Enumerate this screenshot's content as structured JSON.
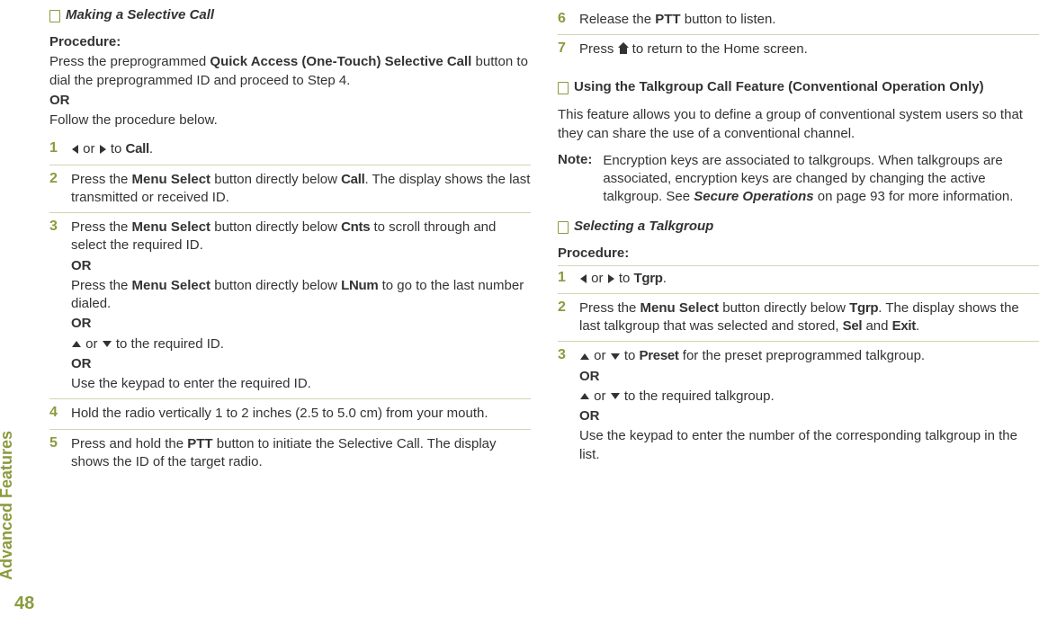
{
  "meta": {
    "side_label": "Advanced Features",
    "page_number": "48"
  },
  "left": {
    "title": "Making a Selective Call",
    "procedure_label": "Procedure:",
    "intro_line1a": "Press the preprogrammed ",
    "intro_line1b": "Quick Access (One-Touch) Selective Call",
    "intro_line1c": " button to dial the preprogrammed ID and proceed to Step 4.",
    "or": "OR",
    "intro_line2": "Follow the procedure below.",
    "steps": {
      "s1": {
        "num": "1",
        "pre": " or ",
        "post": " to ",
        "target": "Call",
        "end": "."
      },
      "s2": {
        "num": "2",
        "a": "Press the ",
        "b": "Menu Select",
        "c": " button directly below ",
        "d": "Call",
        "e": ". The display shows the last transmitted or received ID."
      },
      "s3": {
        "num": "3",
        "l1a": "Press the ",
        "l1b": "Menu Select",
        "l1c": " button directly below ",
        "l1d": "Cnts",
        "l1e": " to scroll through and select the required ID.",
        "l2a": "Press the ",
        "l2b": "Menu Select",
        "l2c": " button directly below ",
        "l2d": "LNum",
        "l2e": " to go to the last number dialed.",
        "l3": " to the required ID.",
        "l4": "Use the keypad to enter the required ID."
      },
      "s4": {
        "num": "4",
        "text": "Hold the radio vertically 1 to 2 inches (2.5 to 5.0 cm) from your mouth."
      },
      "s5": {
        "num": "5",
        "a": "Press and hold the ",
        "b": "PTT",
        "c": " button to initiate the Selective Call. The display shows the ID of the target radio."
      }
    }
  },
  "right": {
    "steps_top": {
      "s6": {
        "num": "6",
        "a": "Release the ",
        "b": "PTT",
        "c": " button to listen."
      },
      "s7": {
        "num": "7",
        "a": "Press ",
        "b": " to return to the Home screen."
      }
    },
    "title2": "Using the Talkgroup Call Feature (Conventional Operation Only)",
    "intro2": "This feature allows you to define a group of conventional system users so that they can share the use of a conventional channel.",
    "note_label": "Note:",
    "note_a": "Encryption keys are associated to talkgroups. When talkgroups are associated, encryption keys are changed by changing the active talkgroup. See ",
    "note_b": "Secure Operations",
    "note_c": " on page 93 for more information.",
    "title3": "Selecting a Talkgroup",
    "procedure_label": "Procedure:",
    "steps2": {
      "s1": {
        "num": "1",
        "post": " to ",
        "target": "Tgrp",
        "end": "."
      },
      "s2": {
        "num": "2",
        "a": "Press the ",
        "b": "Menu Select",
        "c": " button directly below ",
        "d": "Tgrp",
        "e": ". The display shows the last talkgroup that was selected and stored, ",
        "f": "Sel",
        "g": " and ",
        "h": "Exit",
        "i": "."
      },
      "s3": {
        "num": "3",
        "l1a": " to ",
        "l1b": "Preset",
        "l1c": " for the preset preprogrammed talkgroup.",
        "l2": " to the required talkgroup.",
        "l3": "Use the keypad to enter the number of the corresponding talkgroup in the list."
      }
    },
    "or": "OR"
  }
}
